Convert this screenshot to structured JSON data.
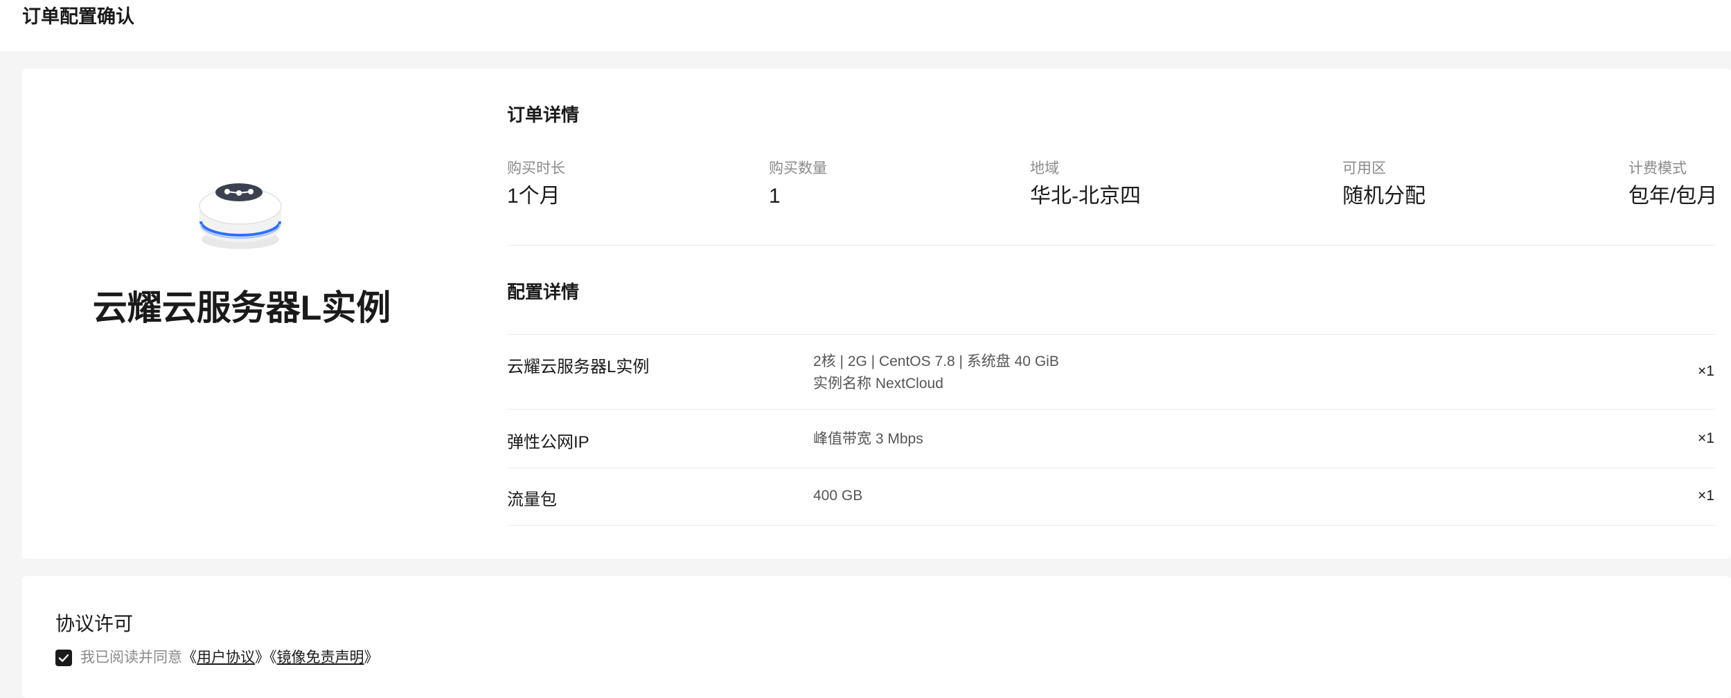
{
  "header": {
    "title": "订单配置确认"
  },
  "product": {
    "name": "云耀云服务器L实例"
  },
  "order": {
    "section_title": "订单详情",
    "fields": [
      {
        "label": "购买时长",
        "value": "1个月"
      },
      {
        "label": "购买数量",
        "value": "1"
      },
      {
        "label": "地域",
        "value": "华北-北京四"
      },
      {
        "label": "可用区",
        "value": "随机分配"
      },
      {
        "label": "计费模式",
        "value": "包年/包月"
      }
    ]
  },
  "config": {
    "section_title": "配置详情",
    "items": [
      {
        "name": "云耀云服务器L实例",
        "spec_line1": "2核 | 2G | CentOS 7.8 | 系统盘 40 GiB",
        "spec_line2": "实例名称 NextCloud",
        "qty": "×1"
      },
      {
        "name": "弹性公网IP",
        "spec_line1": "峰值带宽 3 Mbps",
        "qty": "×1"
      },
      {
        "name": "流量包",
        "spec_line1": "400 GB",
        "qty": "×1"
      }
    ]
  },
  "agreement": {
    "title": "协议许可",
    "checked": true,
    "prefix": "我已阅读并同意",
    "open_bracket": "《",
    "close_bracket": "》",
    "link1": "用户协议",
    "link2": "镜像免责声明"
  },
  "icons": {
    "product": "server-device-icon",
    "checkbox": "checkmark-icon"
  },
  "colors": {
    "background": "#f5f5f5",
    "card": "#ffffff",
    "accent_blue": "#2f6fff",
    "text": "#1a1a1a",
    "muted": "#8a8a8a"
  }
}
